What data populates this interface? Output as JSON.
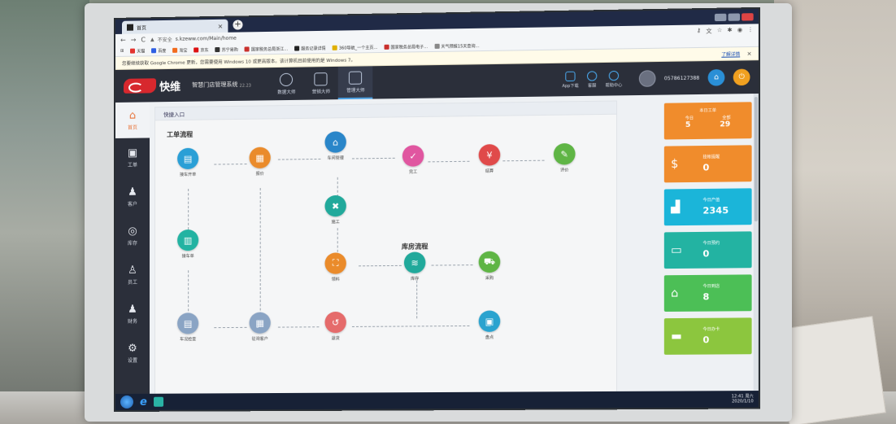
{
  "browser": {
    "tab_title": "首页",
    "new_tab_glyph": "+",
    "url": "s.kzeww.com/Main/home",
    "security_label": "不安全",
    "bookmarks": [
      "天猫",
      "百度",
      "淘宝",
      "京东",
      "苏宁易购",
      "国家税务总局浙江...",
      "服务记录详情",
      "360导航_一个主页...",
      "国家税务总局电子...",
      "天气预报15天查询..."
    ],
    "notice": "您要继续获取 Google Chrome 更新，您需要使用 Windows 10 或更高版本。该计算机目前使用的是 Windows 7。",
    "notice_link": "了解详情",
    "notice_close": "×"
  },
  "app": {
    "brand": "快维",
    "system_name": "智慧门店管理系统",
    "version": "22.23",
    "modules": [
      "数据大师",
      "营销大师",
      "管理大师"
    ],
    "header_links": [
      "App下载",
      "客服",
      "帮助中心"
    ],
    "phone": "05786127388",
    "home_icon": "⌂",
    "power_icon": "⏻"
  },
  "sidebar": [
    {
      "label": "首页",
      "icon": "⌂"
    },
    {
      "label": "工单",
      "icon": "▣"
    },
    {
      "label": "客户",
      "icon": "♟"
    },
    {
      "label": "库存",
      "icon": "◎"
    },
    {
      "label": "员工",
      "icon": "♙"
    },
    {
      "label": "财务",
      "icon": "♟"
    },
    {
      "label": "设置",
      "icon": "⚙"
    }
  ],
  "quick_entry": {
    "title": "快捷入口",
    "workflow_title": "工单流程",
    "warehouse_title": "库房流程",
    "nodes": {
      "open_order": "接车开单",
      "quote": "报价",
      "shop_manage": "车间管理",
      "complete": "完工",
      "settle": "结算",
      "review": "评价",
      "construct": "施工",
      "order_book": "接车单",
      "pick": "领料",
      "inventory": "库存",
      "purchase": "采购",
      "vehicle_check": "车况检查",
      "consult_customer": "征询客户",
      "return": "退货",
      "stocktake": "盘点"
    }
  },
  "cards": {
    "orders": {
      "title": "本日工单",
      "today_label": "今日",
      "total_label": "全部",
      "today": "5",
      "total": "29"
    },
    "debt": {
      "label": "挂帐提醒",
      "value": "0"
    },
    "output": {
      "label": "今日产值",
      "value": "2345"
    },
    "reserve": {
      "label": "今日预约",
      "value": "0"
    },
    "arrival": {
      "label": "今日到店",
      "value": "8"
    },
    "cards_sold": {
      "label": "今日办卡",
      "value": "0"
    }
  },
  "taskbar": {
    "time": "12:41 周六",
    "date": "2020/1/10"
  },
  "colors": {
    "blue": "#2a9fd6",
    "orange": "#ea8b2b",
    "teal": "#21a99b",
    "pink": "#e056a0",
    "red": "#e04a4a",
    "green": "#5fb545",
    "grey": "#8aa4c4",
    "card_orange": "#f08c2c",
    "card_cyan": "#1bb5d9",
    "card_teal": "#23b3a2",
    "card_green": "#4cbf56",
    "card_lime": "#8cc63e"
  }
}
